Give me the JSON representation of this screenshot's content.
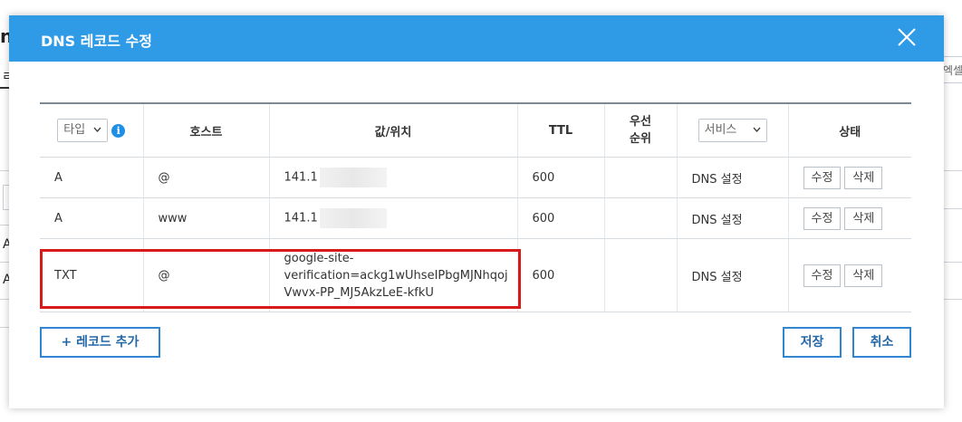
{
  "background": {
    "fragment_title": "n",
    "fragment_tab": "ㄹ",
    "fragment_row1": "A",
    "fragment_row2": "A",
    "fragment_right_btn": "엑셀"
  },
  "modal": {
    "title": "DNS 레코드 수정",
    "close_icon": "close-icon"
  },
  "table": {
    "headers": {
      "type_select": "타입",
      "info_icon": "i",
      "host": "호스트",
      "value": "값/위치",
      "ttl": "TTL",
      "priority_line1": "우선",
      "priority_line2": "순위",
      "service_select": "서비스",
      "status": "상태"
    },
    "rows": [
      {
        "type": "A",
        "host": "@",
        "value": "141.1",
        "ttl": "600",
        "priority": "",
        "service": "DNS 설정",
        "edit": "수정",
        "delete": "삭제"
      },
      {
        "type": "A",
        "host": "www",
        "value": "141.1",
        "ttl": "600",
        "priority": "",
        "service": "DNS 설정",
        "edit": "수정",
        "delete": "삭제"
      },
      {
        "type": "TXT",
        "host": "@",
        "value_line1": "google-site-",
        "value_line2": "verification=ackg1wUhseIPbgMJNhqoj",
        "value_line3": "Vwvx-PP_MJ5AkzLeE-kfkU",
        "ttl": "600",
        "priority": "",
        "service": "DNS 설정",
        "edit": "수정",
        "delete": "삭제"
      }
    ]
  },
  "footer": {
    "add_record": "+ 레코드 추가",
    "save": "저장",
    "cancel": "취소"
  },
  "colors": {
    "header_blue": "#2f9be6",
    "highlight_red": "#d71a1a",
    "button_border": "#2f86d1"
  }
}
